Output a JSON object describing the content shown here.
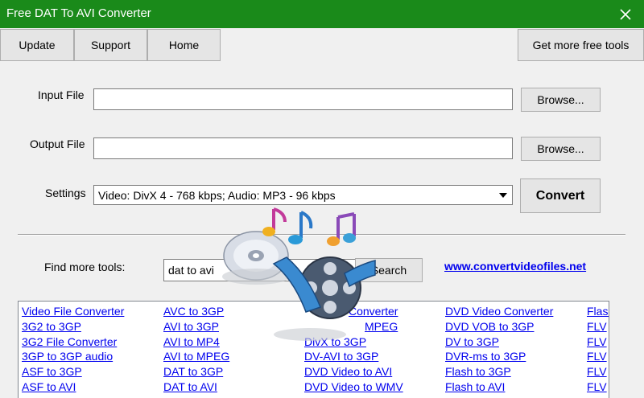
{
  "window": {
    "title": "Free DAT To AVI Converter"
  },
  "toolbar": {
    "update": "Update",
    "support": "Support",
    "home": "Home",
    "more_tools": "Get more free tools"
  },
  "form": {
    "input_label": "Input File",
    "input_value": "",
    "output_label": "Output File",
    "output_value": "",
    "browse": "Browse...",
    "settings_label": "Settings",
    "settings_value": "Video: DivX 4 - 768 kbps; Audio: MP3 - 96 kbps",
    "convert": "Convert"
  },
  "find": {
    "label": "Find more tools:",
    "search_value": "dat to avi",
    "search_button": "Search",
    "site_link": "www.convertvideofiles.net"
  },
  "tools": {
    "col1": [
      "Video File Converter",
      "3G2 to 3GP",
      "3G2 File Converter",
      "3GP to 3GP audio",
      "ASF to 3GP",
      "ASF to AVI"
    ],
    "col2": [
      "AVC to 3GP",
      "AVI to 3GP",
      "AVI to MP4",
      "AVI to MPEG",
      "DAT to 3GP",
      "DAT to AVI"
    ],
    "col3": [
      "Converter",
      "MPEG",
      "DivX to 3GP",
      "DV-AVI to 3GP",
      "DVD Video to AVI",
      "DVD Video to WMV"
    ],
    "col4": [
      "DVD Video Converter",
      "DVD VOB to 3GP",
      "DV to 3GP",
      "DVR-ms to 3GP",
      "Flash to 3GP",
      "Flash to AVI"
    ],
    "col5": [
      "Flash",
      "FLV",
      "FLV",
      "FLV",
      "FLV",
      "FLV"
    ]
  },
  "colors": {
    "titlebar": "#1a8a1a",
    "link": "#0000ee"
  }
}
